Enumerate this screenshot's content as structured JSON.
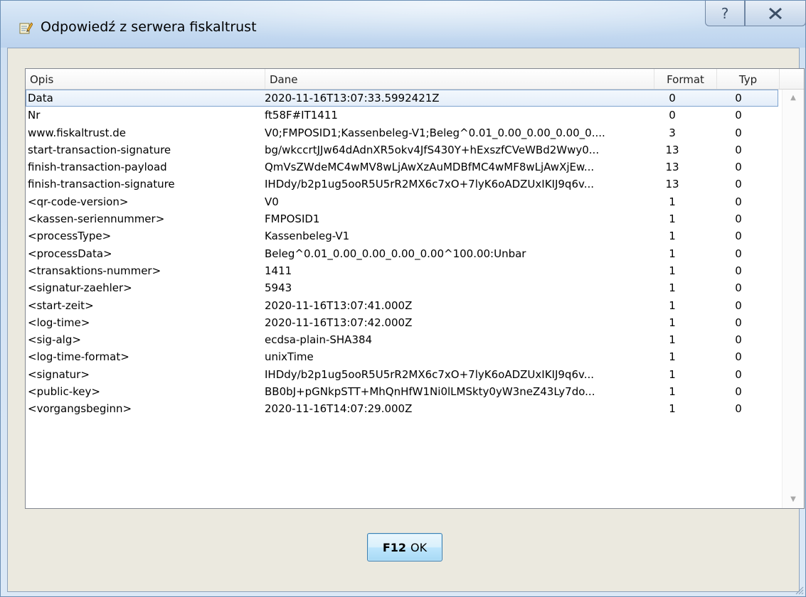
{
  "window": {
    "title": "Odpowiedź z serwera fiskaltrust"
  },
  "list": {
    "headers": {
      "opis": "Opis",
      "dane": "Dane",
      "format": "Format",
      "typ": "Typ"
    },
    "rows": [
      {
        "opis": "Data",
        "dane": "2020-11-16T13:07:33.5992421Z",
        "format": "0",
        "typ": "0"
      },
      {
        "opis": "Nr",
        "dane": "ft58F#IT1411",
        "format": "0",
        "typ": "0"
      },
      {
        "opis": "www.fiskaltrust.de",
        "dane": "V0;FMPOSID1;Kassenbeleg-V1;Beleg^0.01_0.00_0.00_0.00_0....",
        "format": "3",
        "typ": "0"
      },
      {
        "opis": "start-transaction-signature",
        "dane": "bg/wkccrtJJw64dAdnXR5okv4JfS430Y+hExszfCVeWBd2Wwy0...",
        "format": "13",
        "typ": "0"
      },
      {
        "opis": "finish-transaction-payload",
        "dane": "QmVsZWdeMC4wMV8wLjAwXzAuMDBfMC4wMF8wLjAwXjEw...",
        "format": "13",
        "typ": "0"
      },
      {
        "opis": "finish-transaction-signature",
        "dane": "IHDdy/b2p1ug5ooR5U5rR2MX6c7xO+7lyK6oADZUxIKIJ9q6v...",
        "format": "13",
        "typ": "0"
      },
      {
        "opis": "<qr-code-version>",
        "dane": "V0",
        "format": "1",
        "typ": "0"
      },
      {
        "opis": "<kassen-seriennummer>",
        "dane": "FMPOSID1",
        "format": "1",
        "typ": "0"
      },
      {
        "opis": "<processType>",
        "dane": "Kassenbeleg-V1",
        "format": "1",
        "typ": "0"
      },
      {
        "opis": "<processData>",
        "dane": "Beleg^0.01_0.00_0.00_0.00_0.00^100.00:Unbar",
        "format": "1",
        "typ": "0"
      },
      {
        "opis": "<transaktions-nummer>",
        "dane": "1411",
        "format": "1",
        "typ": "0"
      },
      {
        "opis": "<signatur-zaehler>",
        "dane": "5943",
        "format": "1",
        "typ": "0"
      },
      {
        "opis": "<start-zeit>",
        "dane": "2020-11-16T13:07:41.000Z",
        "format": "1",
        "typ": "0"
      },
      {
        "opis": "<log-time>",
        "dane": "2020-11-16T13:07:42.000Z",
        "format": "1",
        "typ": "0"
      },
      {
        "opis": "<sig-alg>",
        "dane": "ecdsa-plain-SHA384",
        "format": "1",
        "typ": "0"
      },
      {
        "opis": "<log-time-format>",
        "dane": "unixTime",
        "format": "1",
        "typ": "0"
      },
      {
        "opis": "<signatur>",
        "dane": "IHDdy/b2p1ug5ooR5U5rR2MX6c7xO+7lyK6oADZUxIKIJ9q6v...",
        "format": "1",
        "typ": "0"
      },
      {
        "opis": "<public-key>",
        "dane": "BB0bJ+pGNkpSTT+MhQnHfW1Ni0lLMSkty0yW3neZ43Ly7do...",
        "format": "1",
        "typ": "0"
      },
      {
        "opis": "<vorgangsbeginn>",
        "dane": "2020-11-16T14:07:29.000Z",
        "format": "1",
        "typ": "0"
      }
    ]
  },
  "ok_button": {
    "key": "F12",
    "label": "OK"
  },
  "icons": {
    "title": "receipt-pencil-icon",
    "help": "help-icon",
    "close": "close-icon",
    "scroll_up": "scroll-up-arrow-icon",
    "scroll_down": "scroll-down-arrow-icon",
    "grip": "resize-grip-icon"
  }
}
